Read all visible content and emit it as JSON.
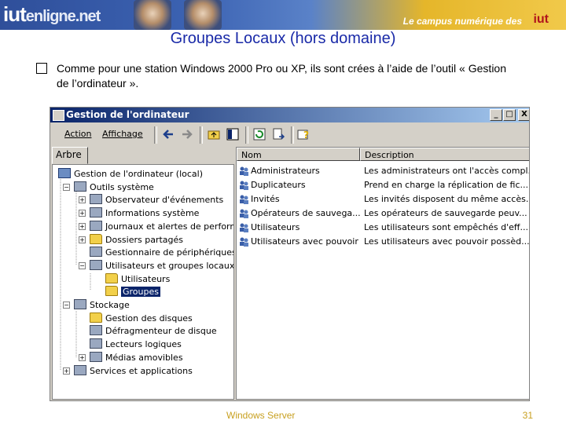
{
  "banner": {
    "logo_main": "iut",
    "logo_sub": "enligne.net",
    "tagline": "Le campus numérique des",
    "logo_right": "iut"
  },
  "slide": {
    "title": "Groupes Locaux (hors domaine)",
    "bullet": "Comme pour une station Windows 2000 Pro ou XP, ils sont crées à l’aide de l’outil « Gestion de l’ordinateur ».",
    "footer_center": "Windows Server",
    "page_number": "31"
  },
  "window": {
    "title": "Gestion de l'ordinateur",
    "menus": [
      "Action",
      "Affichage"
    ],
    "controls": {
      "minimize": "_",
      "maximize": "□",
      "close": "X"
    },
    "tab_label": "Arbre",
    "tree": [
      {
        "label": "Gestion de l'ordinateur (local)",
        "icon": "computer-icon",
        "level": 0,
        "expander": ""
      },
      {
        "label": "Outils système",
        "icon": "tools-icon",
        "level": 1,
        "expander": "−"
      },
      {
        "label": "Observateur d'événements",
        "icon": "event-viewer-icon",
        "level": 2,
        "expander": "+"
      },
      {
        "label": "Informations système",
        "icon": "info-icon",
        "level": 2,
        "expander": "+"
      },
      {
        "label": "Journaux et alertes de performar",
        "icon": "performance-icon",
        "level": 2,
        "expander": "+"
      },
      {
        "label": "Dossiers partagés",
        "icon": "folder-icon",
        "level": 2,
        "expander": "+"
      },
      {
        "label": "Gestionnaire de périphériques",
        "icon": "device-manager-icon",
        "level": 2,
        "expander": ""
      },
      {
        "label": "Utilisateurs et groupes locaux",
        "icon": "users-icon",
        "level": 2,
        "expander": "−"
      },
      {
        "label": "Utilisateurs",
        "icon": "folder-icon",
        "level": 3,
        "expander": ""
      },
      {
        "label": "Groupes",
        "icon": "folder-open-icon",
        "level": 3,
        "expander": "",
        "selected": true
      },
      {
        "label": "Stockage",
        "icon": "storage-icon",
        "level": 1,
        "expander": "−"
      },
      {
        "label": "Gestion des disques",
        "icon": "folder-icon",
        "level": 2,
        "expander": ""
      },
      {
        "label": "Défragmenteur de disque",
        "icon": "defrag-icon",
        "level": 2,
        "expander": ""
      },
      {
        "label": "Lecteurs logiques",
        "icon": "drive-icon",
        "level": 2,
        "expander": ""
      },
      {
        "label": "Médias amovibles",
        "icon": "removable-media-icon",
        "level": 2,
        "expander": "+"
      },
      {
        "label": "Services et applications",
        "icon": "services-icon",
        "level": 1,
        "expander": "+"
      }
    ],
    "columns": {
      "name": "Nom",
      "description": "Description"
    },
    "groups": [
      {
        "name": "Administrateurs",
        "description": "Les administrateurs ont l'accès compl..."
      },
      {
        "name": "Duplicateurs",
        "description": "Prend en charge la réplication de fic..."
      },
      {
        "name": "Invités",
        "description": "Les invités disposent du même accès..."
      },
      {
        "name": "Opérateurs de sauvega...",
        "description": "Les opérateurs de sauvegarde peuv..."
      },
      {
        "name": "Utilisateurs",
        "description": "Les utilisateurs sont empêchés d'eff..."
      },
      {
        "name": "Utilisateurs avec pouvoir",
        "description": "Les utilisateurs avec pouvoir possèd..."
      }
    ]
  },
  "colors": {
    "title_blue": "#1a2aa8",
    "footer_gold": "#c8a020",
    "titlebar_start": "#0a246a",
    "titlebar_end": "#a6caf0",
    "window_face": "#d4d0c8"
  }
}
